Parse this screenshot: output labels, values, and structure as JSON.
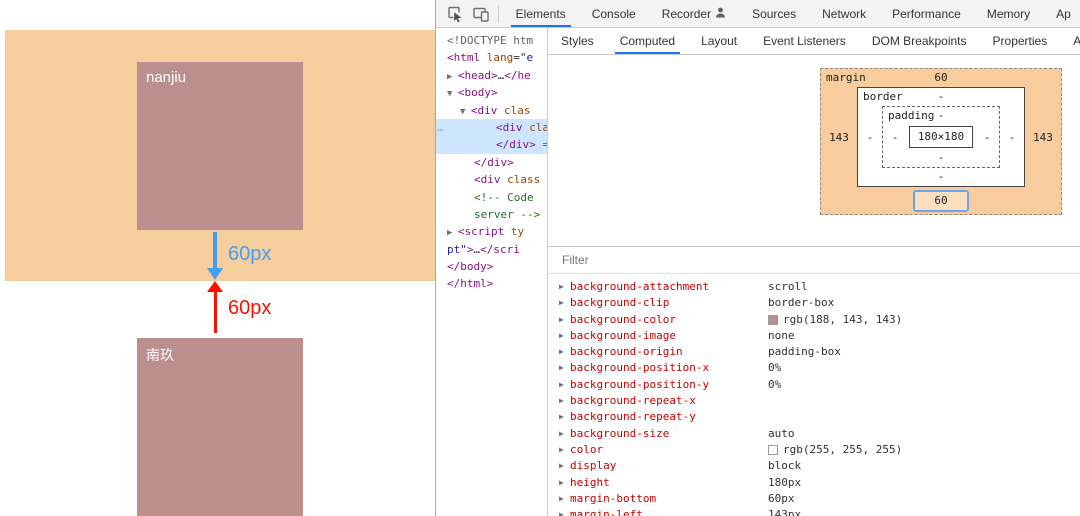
{
  "page": {
    "colors": {
      "page_bg": "#f6ce9e",
      "box_bg": "#bc8f8f",
      "blue": "#429ef5",
      "red": "#fb1000"
    },
    "box1_label": "nanjiu",
    "box2_label": "南玖",
    "blue_margin_label": "60px",
    "red_margin_label": "60px"
  },
  "devtools": {
    "colors": {
      "accent": "#1a73e8",
      "bm_margin_bg": "#f9cc9d",
      "highlight_row": "#cde6fd"
    },
    "main_tabs": [
      {
        "label": "Elements",
        "selected": true
      },
      {
        "label": "Console"
      },
      {
        "label": "Recorder",
        "has_icon": true
      },
      {
        "label": "Sources"
      },
      {
        "label": "Network"
      },
      {
        "label": "Performance"
      },
      {
        "label": "Memory"
      },
      {
        "label": "Ap"
      }
    ],
    "sub_tabs": [
      {
        "label": "Styles"
      },
      {
        "label": "Computed",
        "selected": true
      },
      {
        "label": "Layout"
      },
      {
        "label": "Event Listeners"
      },
      {
        "label": "DOM Breakpoints"
      },
      {
        "label": "Properties"
      },
      {
        "label": "Access"
      }
    ],
    "dom_tree_lines": [
      {
        "indent": 0,
        "segments": [
          {
            "t": "<!DOCTYPE htm",
            "c": "gray"
          }
        ]
      },
      {
        "indent": 0,
        "segments": [
          {
            "t": "<html",
            "c": "tag"
          },
          {
            "t": " lang",
            "c": "attr"
          },
          {
            "t": "=",
            "c": "plain"
          },
          {
            "t": "\"e",
            "c": "val"
          }
        ]
      },
      {
        "indent": 0,
        "segments": [
          {
            "t": "▶ ",
            "c": "arrow"
          },
          {
            "t": "<head>",
            "c": "tag"
          },
          {
            "t": "…",
            "c": "plain"
          },
          {
            "t": "</he",
            "c": "tag"
          }
        ]
      },
      {
        "indent": 0,
        "segments": [
          {
            "t": "▼ ",
            "c": "arrow"
          },
          {
            "t": "<body>",
            "c": "tag"
          }
        ]
      },
      {
        "indent": 13,
        "segments": [
          {
            "t": "▼ ",
            "c": "arrow"
          },
          {
            "t": "<div",
            "c": "tag"
          },
          {
            "t": " clas",
            "c": "attr"
          }
        ]
      },
      {
        "indent": 49,
        "highlighted": true,
        "gutter": "…",
        "segments": [
          {
            "t": "<div",
            "c": "tag"
          },
          {
            "t": " cla",
            "c": "attr"
          }
        ]
      },
      {
        "indent": 49,
        "highlighted": true,
        "segments": [
          {
            "t": "</div>",
            "c": "tag"
          },
          {
            "t": " =",
            "c": "gray"
          }
        ]
      },
      {
        "indent": 27,
        "segments": [
          {
            "t": "</div>",
            "c": "tag"
          }
        ]
      },
      {
        "indent": 27,
        "segments": [
          {
            "t": "<div",
            "c": "tag"
          },
          {
            "t": " class",
            "c": "attr"
          }
        ]
      },
      {
        "indent": 27,
        "segments": [
          {
            "t": "<!-- Code",
            "c": "comment"
          }
        ]
      },
      {
        "indent": 27,
        "segments": [
          {
            "t": "server -->",
            "c": "comment"
          }
        ]
      },
      {
        "indent": 0,
        "segments": [
          {
            "t": "▶ ",
            "c": "arrow"
          },
          {
            "t": "<script",
            "c": "tag"
          },
          {
            "t": " ty",
            "c": "attr"
          }
        ]
      },
      {
        "indent": 0,
        "segments": [
          {
            "t": "pt\"",
            "c": "val"
          },
          {
            "t": ">",
            "c": "tag"
          },
          {
            "t": "…",
            "c": "plain"
          },
          {
            "t": "</scri",
            "c": "tag"
          }
        ]
      },
      {
        "indent": 0,
        "segments": [
          {
            "t": "</body>",
            "c": "tag"
          }
        ]
      },
      {
        "indent": 0,
        "segments": [
          {
            "t": "</html>",
            "c": "tag"
          }
        ]
      }
    ],
    "box_model": {
      "margin_label": "margin",
      "margin_top": "60",
      "margin_right": "143",
      "margin_bottom": "60",
      "margin_left": "143",
      "border_label": "border",
      "border_top": "-",
      "border_right": "-",
      "border_bottom": "-",
      "border_left": "-",
      "padding_label": "padding",
      "padding_top": "-",
      "padding_right": "-",
      "padding_bottom": "-",
      "padding_left": "-",
      "content": "180×180"
    },
    "filter_placeholder": "Filter",
    "computed_properties": [
      {
        "name": "background-attachment",
        "value": "scroll"
      },
      {
        "name": "background-clip",
        "value": "border-box"
      },
      {
        "name": "background-color",
        "value": "rgb(188, 143, 143)",
        "swatch": "#bc8f8f"
      },
      {
        "name": "background-image",
        "value": "none"
      },
      {
        "name": "background-origin",
        "value": "padding-box"
      },
      {
        "name": "background-position-x",
        "value": "0%"
      },
      {
        "name": "background-position-y",
        "value": "0%"
      },
      {
        "name": "background-repeat-x",
        "value": ""
      },
      {
        "name": "background-repeat-y",
        "value": ""
      },
      {
        "name": "background-size",
        "value": "auto"
      },
      {
        "name": "color",
        "value": "rgb(255, 255, 255)",
        "swatch": "#ffffff"
      },
      {
        "name": "display",
        "value": "block"
      },
      {
        "name": "height",
        "value": "180px"
      },
      {
        "name": "margin-bottom",
        "value": "60px"
      },
      {
        "name": "margin-left",
        "value": "143px"
      }
    ]
  }
}
